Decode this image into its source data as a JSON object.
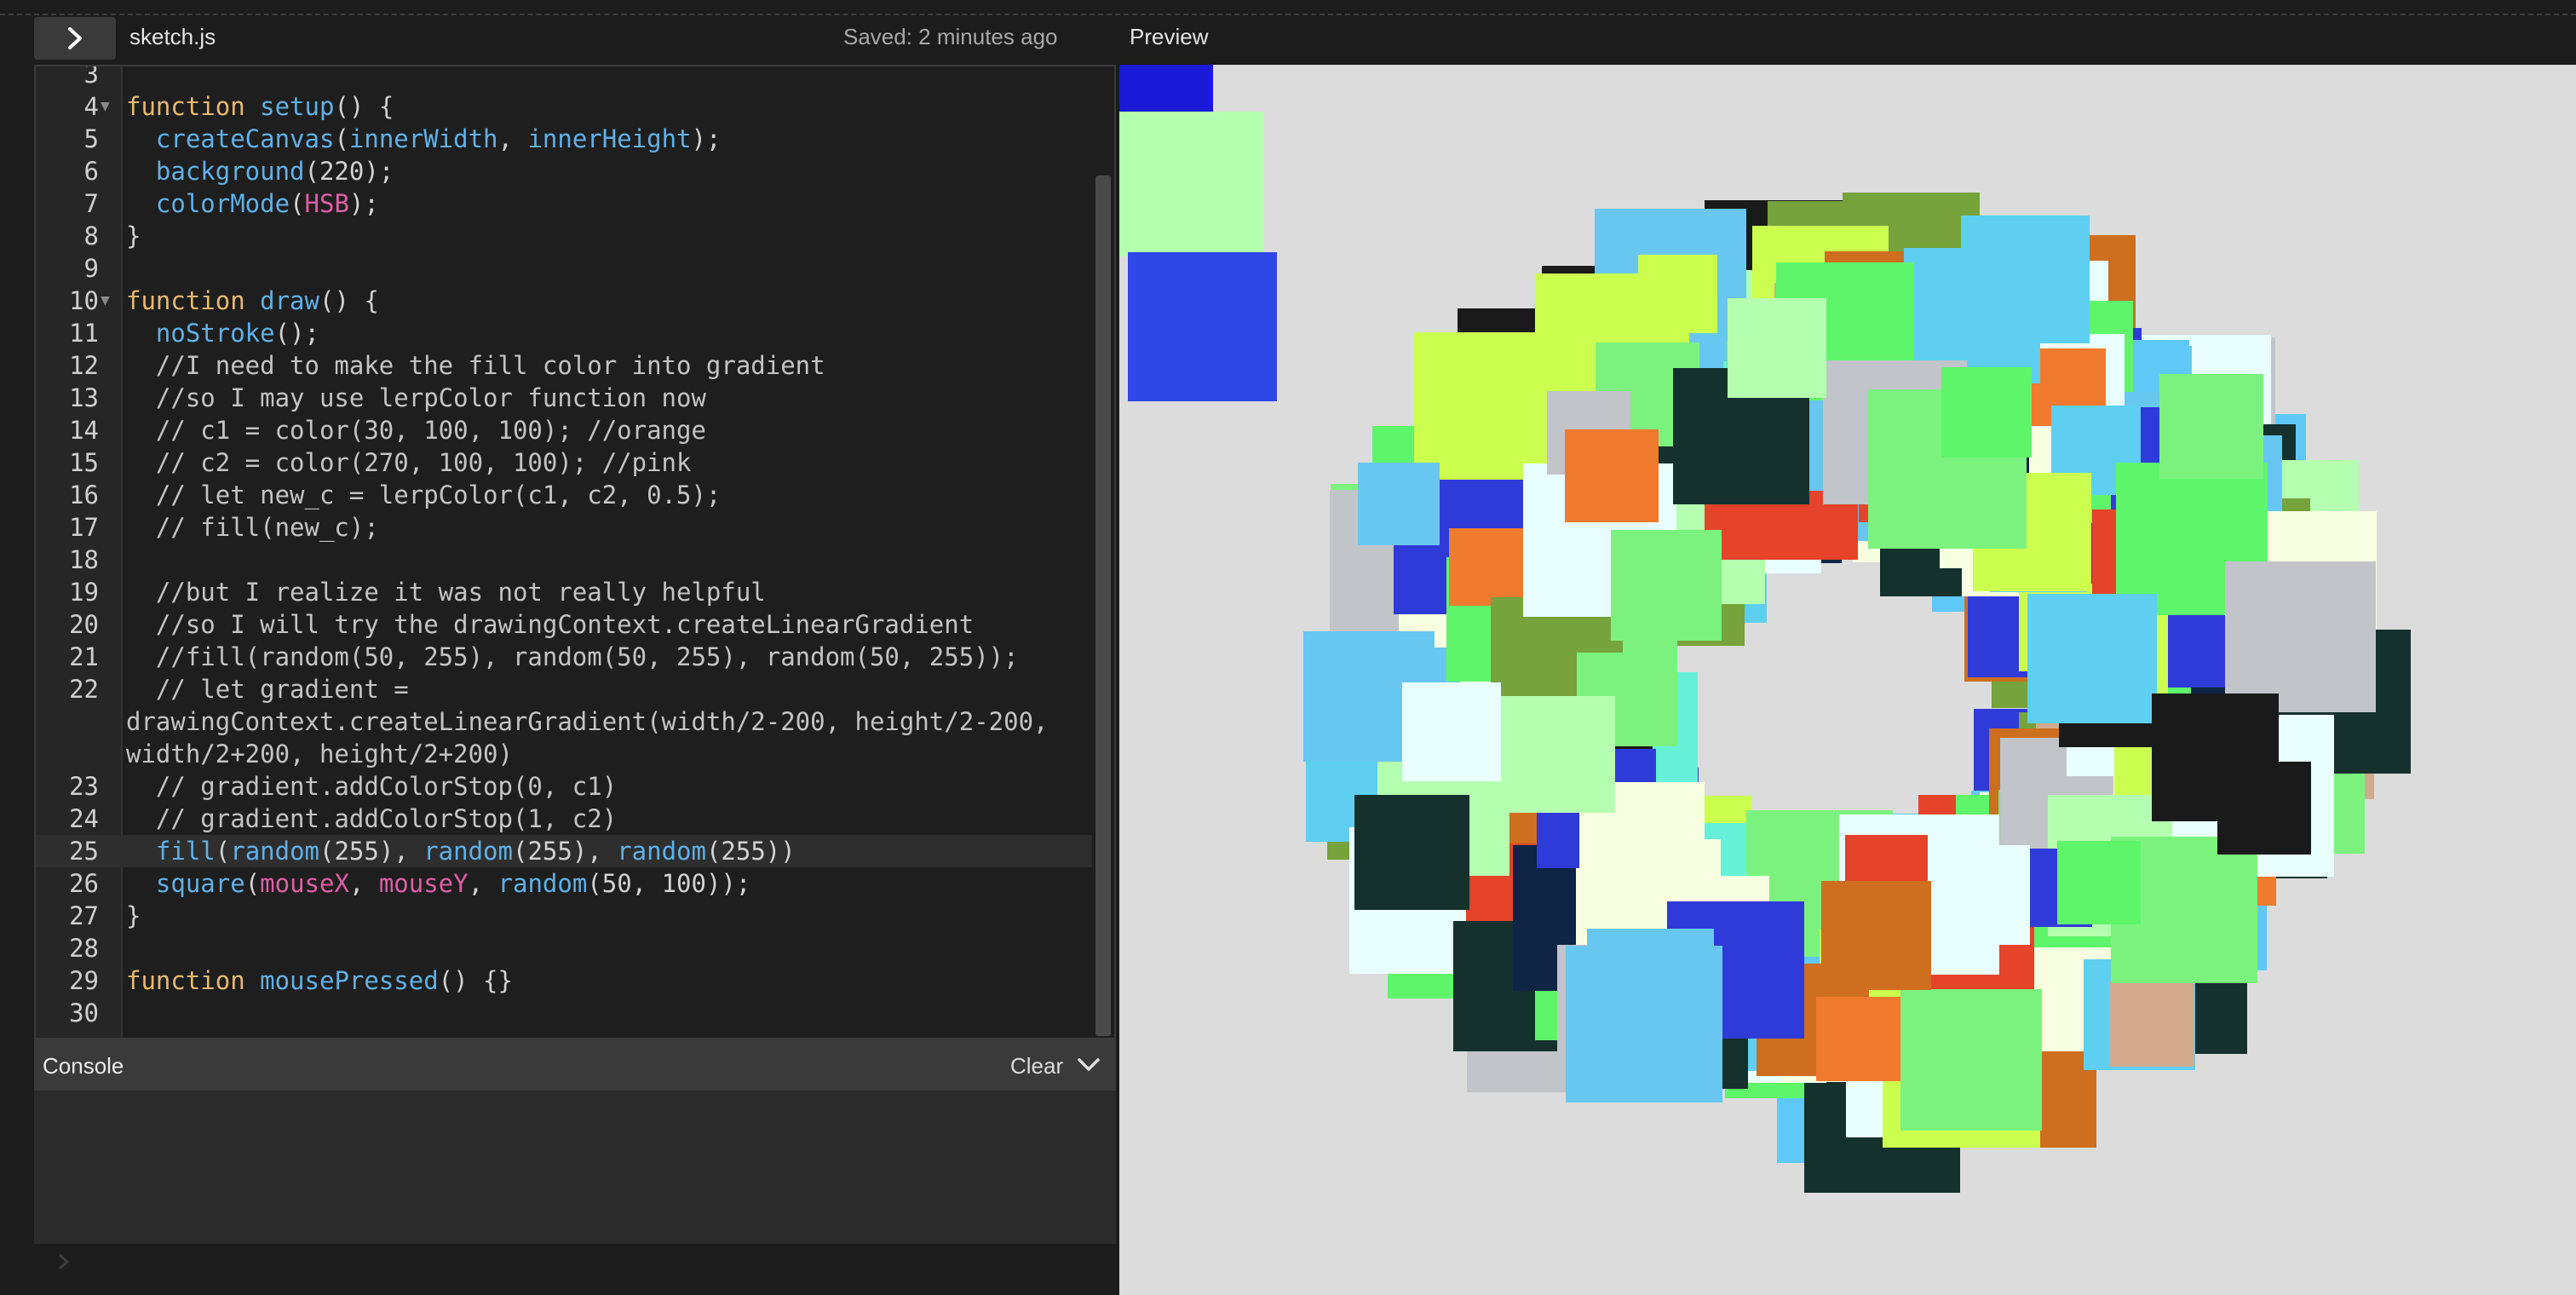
{
  "toolbar": {
    "toggle_icon": "chevron-right-icon",
    "filename": "sketch.js",
    "saved_status": "Saved: 2 minutes ago",
    "preview_label": "Preview"
  },
  "editor": {
    "lines": [
      {
        "n": "3",
        "fold": "",
        "segs": []
      },
      {
        "n": "4",
        "fold": "▼",
        "segs": [
          [
            "kw",
            "function "
          ],
          [
            "fn",
            "setup"
          ],
          [
            "",
            "() {"
          ]
        ]
      },
      {
        "n": "5",
        "fold": "",
        "segs": [
          [
            "fn",
            "  createCanvas"
          ],
          [
            "",
            "("
          ],
          [
            "fn",
            "innerWidth"
          ],
          [
            "",
            ", "
          ],
          [
            "fn",
            "innerHeight"
          ],
          [
            "",
            ");"
          ]
        ]
      },
      {
        "n": "6",
        "fold": "",
        "segs": [
          [
            "fn",
            "  background"
          ],
          [
            "",
            "(220);"
          ]
        ]
      },
      {
        "n": "7",
        "fold": "",
        "segs": [
          [
            "fn",
            "  colorMode"
          ],
          [
            "",
            "("
          ],
          [
            "pk",
            "HSB"
          ],
          [
            "",
            ");"
          ]
        ]
      },
      {
        "n": "8",
        "fold": "",
        "segs": [
          [
            "",
            "}"
          ]
        ]
      },
      {
        "n": "9",
        "fold": "",
        "segs": []
      },
      {
        "n": "10",
        "fold": "▼",
        "segs": [
          [
            "kw",
            "function "
          ],
          [
            "fn",
            "draw"
          ],
          [
            "",
            "() {"
          ]
        ]
      },
      {
        "n": "11",
        "fold": "",
        "segs": [
          [
            "fn",
            "  noStroke"
          ],
          [
            "",
            "();"
          ]
        ]
      },
      {
        "n": "12",
        "fold": "",
        "segs": [
          [
            "cm",
            "  //I need to make the fill color into gradient"
          ]
        ]
      },
      {
        "n": "13",
        "fold": "",
        "segs": [
          [
            "cm",
            "  //so I may use lerpColor function now"
          ]
        ]
      },
      {
        "n": "14",
        "fold": "",
        "segs": [
          [
            "cm",
            "  // c1 = color(30, 100, 100); //orange"
          ]
        ]
      },
      {
        "n": "15",
        "fold": "",
        "segs": [
          [
            "cm",
            "  // c2 = color(270, 100, 100); //pink"
          ]
        ]
      },
      {
        "n": "16",
        "fold": "",
        "segs": [
          [
            "cm",
            "  // let new_c = lerpColor(c1, c2, 0.5);"
          ]
        ]
      },
      {
        "n": "17",
        "fold": "",
        "segs": [
          [
            "cm",
            "  // fill(new_c);"
          ]
        ]
      },
      {
        "n": "18",
        "fold": "",
        "segs": []
      },
      {
        "n": "19",
        "fold": "",
        "segs": [
          [
            "cm",
            "  //but I realize it was not really helpful"
          ]
        ]
      },
      {
        "n": "20",
        "fold": "",
        "segs": [
          [
            "cm",
            "  //so I will try the drawingContext.createLinearGradient"
          ]
        ]
      },
      {
        "n": "21",
        "fold": "",
        "segs": [
          [
            "cm",
            "  //fill(random(50, 255), random(50, 255), random(50, 255));"
          ]
        ]
      },
      {
        "n": "22",
        "fold": "",
        "segs": [
          [
            "cm",
            "  // let gradient ="
          ]
        ]
      },
      {
        "n": "",
        "fold": "",
        "segs": [
          [
            "cm",
            "drawingContext.createLinearGradient(width/2-200, height/2-200,"
          ]
        ]
      },
      {
        "n": "",
        "fold": "",
        "segs": [
          [
            "cm",
            "width/2+200, height/2+200)"
          ]
        ]
      },
      {
        "n": "23",
        "fold": "",
        "segs": [
          [
            "cm",
            "  // gradient.addColorStop(0, c1)"
          ]
        ]
      },
      {
        "n": "24",
        "fold": "",
        "segs": [
          [
            "cm",
            "  // gradient.addColorStop(1, c2)"
          ]
        ]
      },
      {
        "n": "25",
        "fold": "",
        "cur": true,
        "segs": [
          [
            "fn",
            "  fill"
          ],
          [
            "",
            "("
          ],
          [
            "fn",
            "random"
          ],
          [
            "",
            "(255), "
          ],
          [
            "fn",
            "random"
          ],
          [
            "",
            "(255), "
          ],
          [
            "fn",
            "random"
          ],
          [
            "",
            "(255))"
          ]
        ]
      },
      {
        "n": "26",
        "fold": "",
        "segs": [
          [
            "fn",
            "  square"
          ],
          [
            "",
            "("
          ],
          [
            "pk",
            "mouseX"
          ],
          [
            "",
            ", "
          ],
          [
            "pk",
            "mouseY"
          ],
          [
            "",
            ", "
          ],
          [
            "fn",
            "random"
          ],
          [
            "",
            "(50, 100));"
          ]
        ]
      },
      {
        "n": "27",
        "fold": "",
        "segs": [
          [
            "",
            "}"
          ]
        ]
      },
      {
        "n": "28",
        "fold": "",
        "segs": []
      },
      {
        "n": "29",
        "fold": "",
        "segs": [
          [
            "kw",
            "function "
          ],
          [
            "fn",
            "mousePressed"
          ],
          [
            "",
            "() {}"
          ]
        ]
      },
      {
        "n": "30",
        "fold": "",
        "segs": []
      }
    ]
  },
  "console": {
    "label": "Console",
    "clear_label": "Clear",
    "collapse_icon": "chevron-down-icon",
    "prompt_icon": "chevron-right-icon"
  },
  "preview": {
    "background": "#dcdcdc",
    "palette": [
      "#5ff56b",
      "#67f0d8",
      "#f07a2e",
      "#1a1a1a",
      "#2f3bd9",
      "#b5ffb0",
      "#60c8f7",
      "#e5432a",
      "#7cf27e",
      "#0e2545",
      "#f8ffe0",
      "#5ecff0",
      "#76a33c",
      "#ce6e1f",
      "#15312e",
      "#d1aa8e",
      "#68c7f0",
      "#ccfe50",
      "#c1c4c9",
      "#e9ffff"
    ]
  }
}
